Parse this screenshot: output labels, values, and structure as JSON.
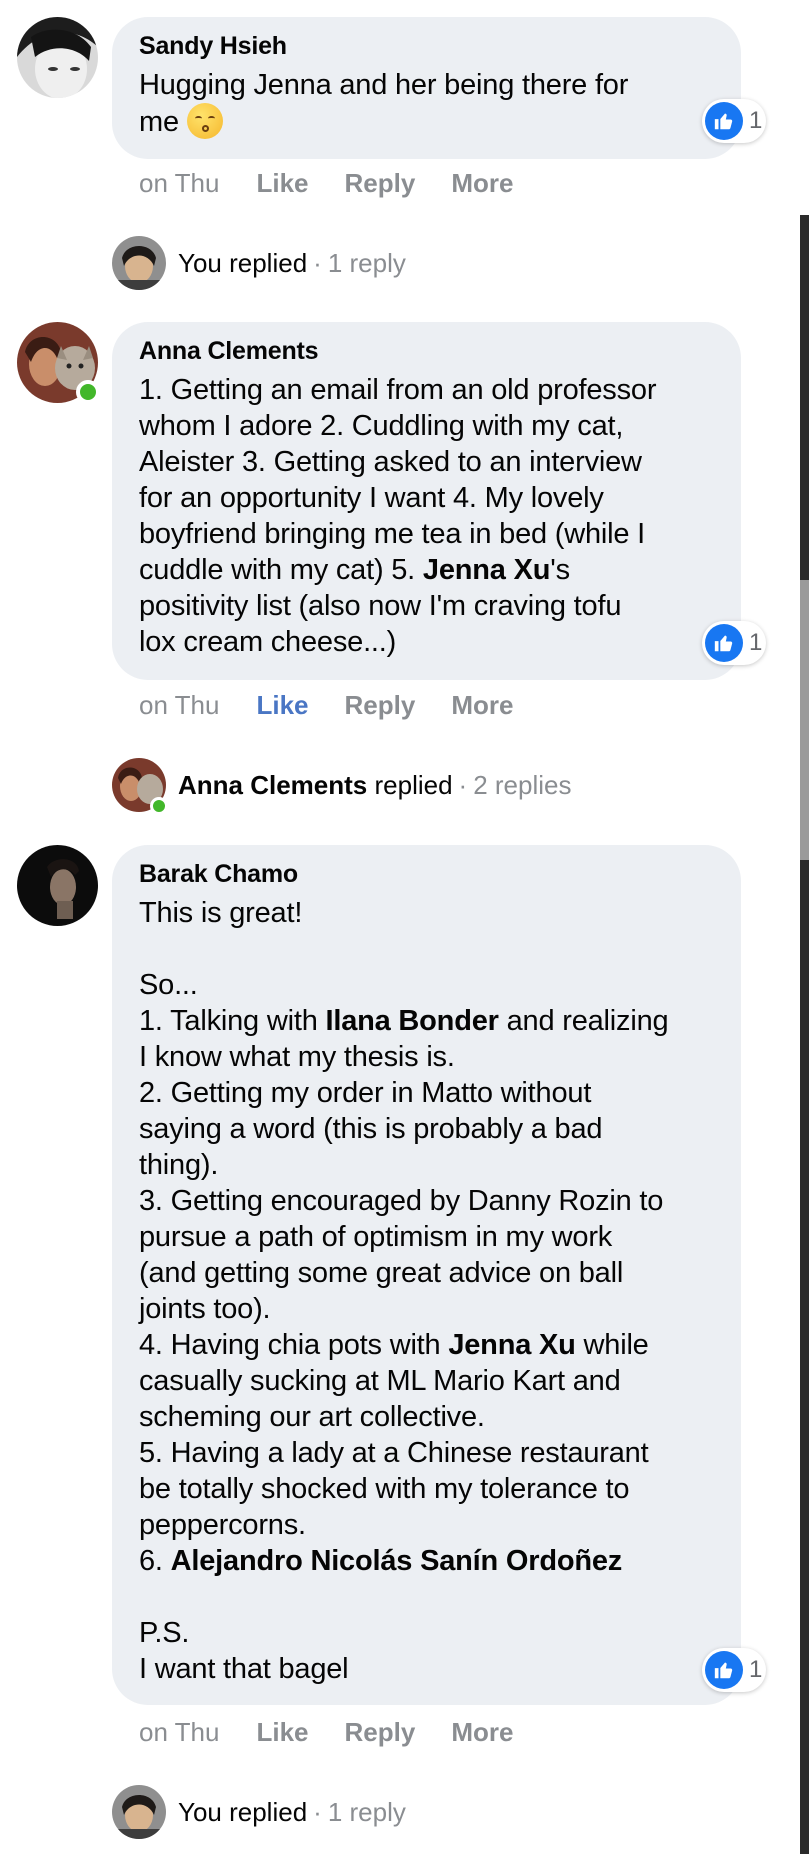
{
  "comments": [
    {
      "author": "Sandy Hsieh",
      "lines": [
        "Hugging Jenna and her being there for",
        "me"
      ],
      "reaction_count": "1",
      "time": "on Thu",
      "like_label": "Like",
      "reply_label": "Reply",
      "more_label": "More",
      "replies": {
        "who": "You replied",
        "dot": "·",
        "count": "1 reply"
      }
    },
    {
      "author": "Anna Clements",
      "lines": [
        "1. Getting an email from an old professor",
        "whom I adore 2. Cuddling with my cat,",
        "Aleister 3. Getting asked to an interview",
        "for an opportunity I want 4. My lovely",
        "boyfriend bringing me tea in bed (while I",
        "cuddle with my cat) 5. ",
        "Jenna Xu",
        "'s",
        "positivity list (also now I'm craving tofu",
        "lox cream cheese...)"
      ],
      "reaction_count": "1",
      "time": "on Thu",
      "like_label": "Like",
      "reply_label": "Reply",
      "more_label": "More",
      "replies": {
        "who_name": "Anna Clements",
        "who_suffix": " replied",
        "dot": "·",
        "count": "2 replies"
      }
    },
    {
      "author": "Barak Chamo",
      "lines": [
        "This is great!",
        "",
        "So...",
        "1. Talking with ",
        "Ilana Bonder",
        " and realizing",
        "I know what my thesis is.",
        "2. Getting my order in Matto without",
        "saying a word (this is probably a bad",
        "thing).",
        "3. Getting encouraged by Danny Rozin to",
        "pursue a path of optimism in my work",
        "(and getting some great advice on ball",
        "joints too).",
        "4. Having chia pots with ",
        "Jenna Xu",
        " while",
        "casually sucking at ML Mario Kart and",
        "scheming our art collective.",
        "5. Having a lady at a Chinese restaurant",
        "be totally shocked with my tolerance to",
        "peppercorns.",
        "6. ",
        "Alejandro Nicolás Sanín Ordoñez",
        "",
        "P.S.",
        "I want that bagel"
      ],
      "reaction_count": "1",
      "time": "on Thu",
      "like_label": "Like",
      "reply_label": "Reply",
      "more_label": "More",
      "replies": {
        "who": "You replied",
        "dot": "·",
        "count": "1 reply"
      }
    }
  ],
  "colors": {
    "bubble": "#eceff3",
    "like_blue": "#1877f2",
    "liked_text": "#4a76c4",
    "meta_gray": "#8a8d91",
    "online_green": "#42b72a"
  }
}
